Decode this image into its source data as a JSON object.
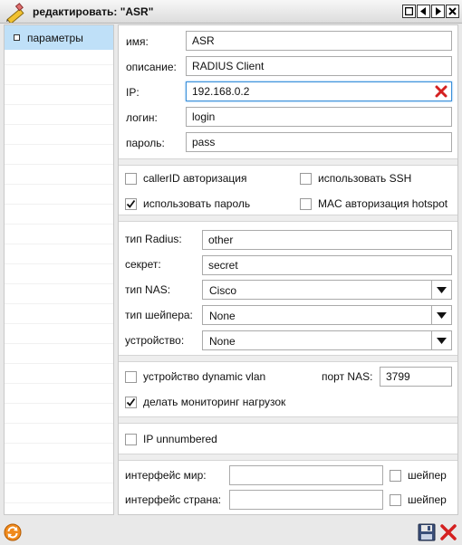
{
  "window": {
    "title": "редактировать: \"ASR\""
  },
  "sidebar": {
    "items": [
      {
        "label": "параметры",
        "selected": true
      }
    ]
  },
  "form": {
    "name": {
      "label": "имя:",
      "value": "ASR"
    },
    "desc": {
      "label": "описание:",
      "value": "RADIUS Client"
    },
    "ip": {
      "label": "IP:",
      "value": "192.168.0.2"
    },
    "login": {
      "label": "логин:",
      "value": "login"
    },
    "password": {
      "label": "пароль:",
      "value": "pass"
    }
  },
  "auth_options": {
    "callerid": {
      "label": "callerID авторизация",
      "checked": false
    },
    "ssh": {
      "label": "использовать SSH",
      "checked": false
    },
    "use_pass": {
      "label": "использовать пароль",
      "checked": true
    },
    "mac_auth": {
      "label": "MAC авторизация hotspot",
      "checked": false
    }
  },
  "radius": {
    "type": {
      "label": "тип Radius:",
      "value": "other"
    },
    "secret": {
      "label": "секрет:",
      "value": "secret"
    },
    "nas": {
      "label": "тип NAS:",
      "value": "Cisco"
    },
    "shaper": {
      "label": "тип шейпера:",
      "value": "None"
    },
    "device": {
      "label": "устройство:",
      "value": "None"
    }
  },
  "vlan": {
    "dynamic": {
      "label": "устройство dynamic vlan",
      "checked": false
    },
    "nas_port": {
      "label": "порт NAS:",
      "value": "3799"
    },
    "monitor": {
      "label": "делать мониторинг нагрузок",
      "checked": true
    }
  },
  "ip_unnumbered": {
    "label": "IP unnumbered",
    "checked": false
  },
  "interfaces": {
    "world": {
      "label": "интерфейс мир:",
      "value": "",
      "shaper_label": "шейпер",
      "shaper_checked": false
    },
    "country": {
      "label": "интерфейс страна:",
      "value": "",
      "shaper_label": "шейпер",
      "shaper_checked": false
    }
  },
  "colors": {
    "selection": "#bfe0f8",
    "focus_border": "#3a8fd9",
    "clear_icon": "#d42020"
  },
  "icons": [
    "pencil-icon",
    "maximize-icon",
    "prev-icon",
    "next-icon",
    "close-icon",
    "clear-icon",
    "chevron-down-icon",
    "refresh-icon",
    "save-icon",
    "cancel-icon"
  ]
}
